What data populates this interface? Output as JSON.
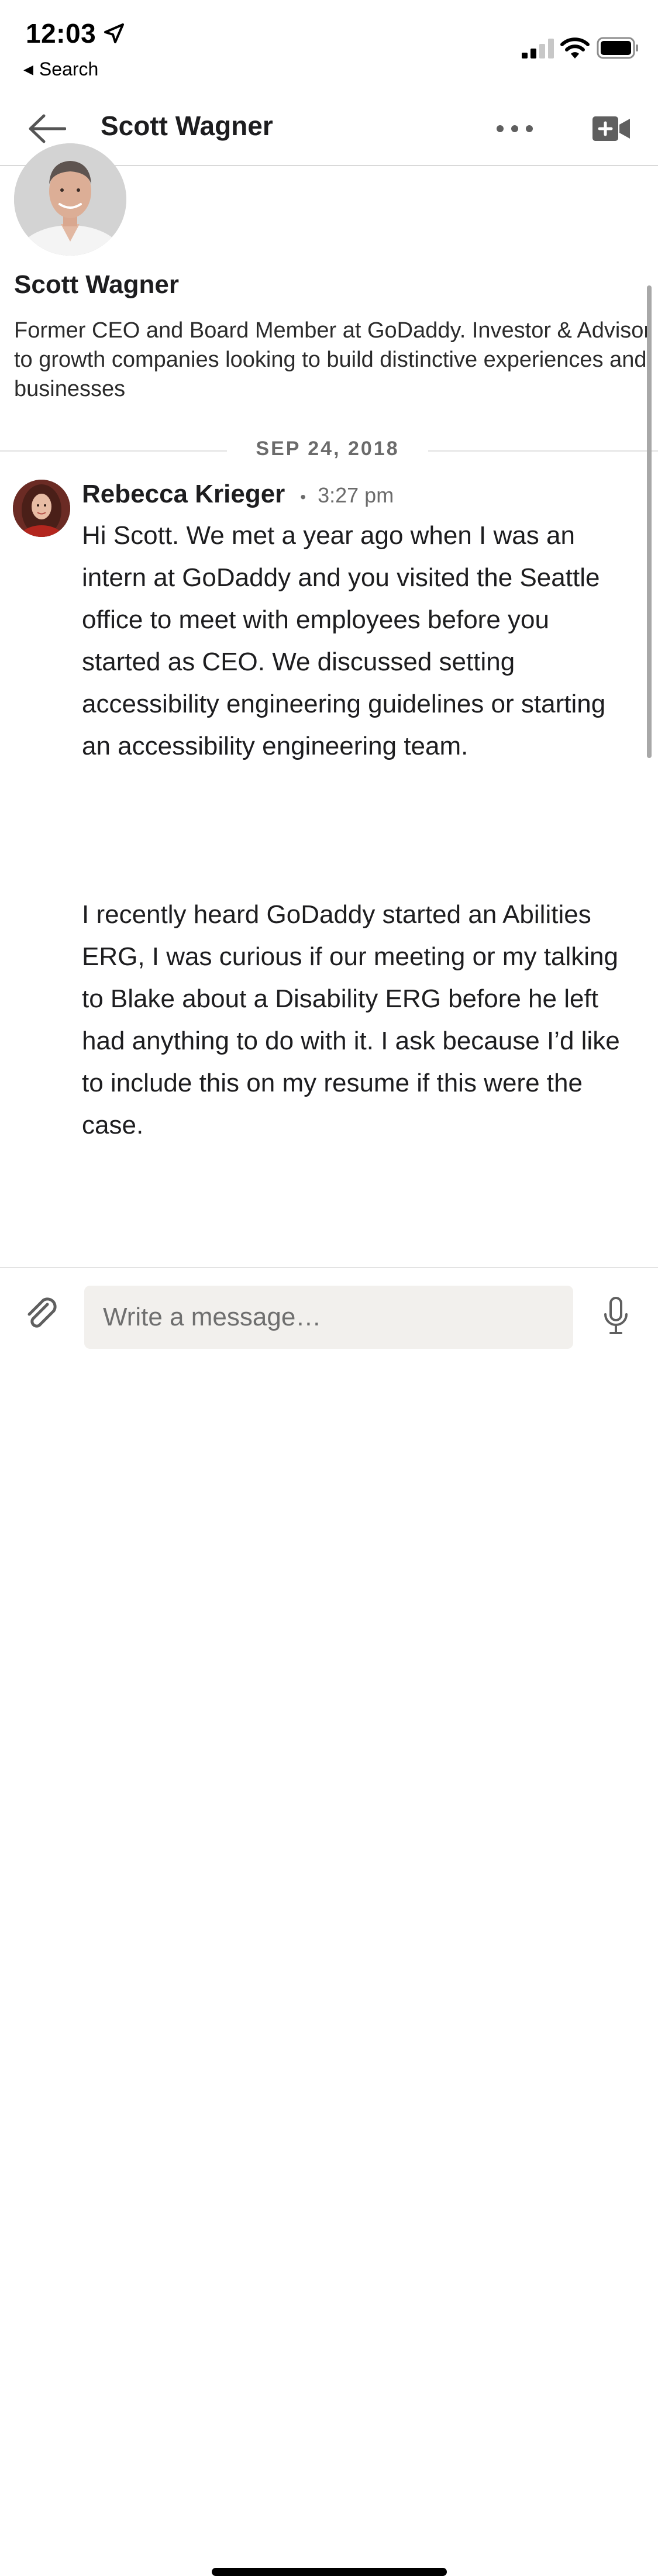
{
  "status_bar": {
    "time": "12:03",
    "back_app_label": "Search",
    "icons": [
      "location-arrow-icon",
      "cellular-signal-icon",
      "wifi-icon",
      "battery-icon"
    ]
  },
  "header": {
    "title": "Scott Wagner",
    "icons": [
      "back-arrow-icon",
      "more-options-icon",
      "video-call-icon"
    ]
  },
  "profile": {
    "name": "Scott Wagner",
    "headline": "Former CEO and Board Member at GoDaddy. Investor & Advisor to growth companies looking to build distinctive experiences and businesses"
  },
  "conversation": {
    "date_label": "SEP 24, 2018",
    "messages": [
      {
        "sender": "Rebecca Krieger",
        "separator": "•",
        "time": "3:27 pm",
        "paragraphs": [
          "Hi Scott. We met a year ago when I was an intern at GoDaddy and you visited the Seattle office to meet with employees before you started as CEO. We discussed setting accessibility engineering guidelines or starting an accessibility engineering team.",
          "I recently heard GoDaddy started an Abilities ERG, I was curious if our meeting or my talking to Blake about a Disability ERG before he left had anything to do with it. I ask because I’d like to include this on my resume if this were the case."
        ]
      }
    ]
  },
  "composer": {
    "placeholder": "Write a message…",
    "value": "",
    "icons": [
      "paperclip-icon",
      "microphone-icon"
    ]
  },
  "colors": {
    "text_primary": "#1d1d1f",
    "text_secondary": "#6b6b6b",
    "divider": "#d9d9d9",
    "input_background": "#f2f0ed",
    "icon_gray": "#5f5f5f"
  }
}
